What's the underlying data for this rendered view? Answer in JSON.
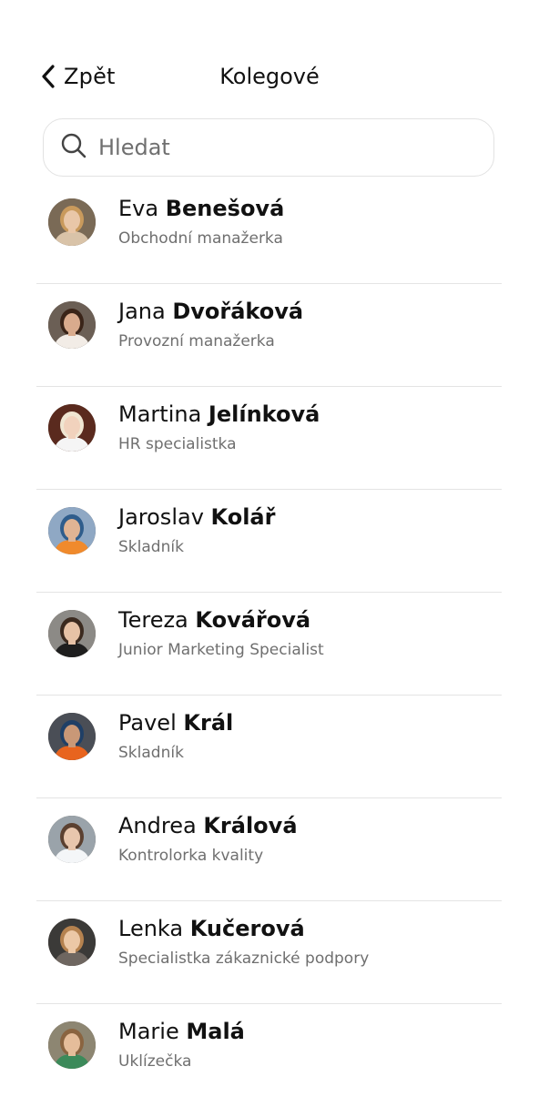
{
  "header": {
    "back_label": "Zpět",
    "title": "Kolegové"
  },
  "search": {
    "placeholder": "Hledat",
    "value": ""
  },
  "colleagues": [
    {
      "first": "Eva",
      "last": "Benešová",
      "role": "Obchodní manažerka",
      "avatar": {
        "bg": "#7a6a56",
        "hair": "#c99a5c",
        "skin": "#e9c7a8",
        "shirt": "#d9c3a8"
      }
    },
    {
      "first": "Jana",
      "last": "Dvořáková",
      "role": "Provozní manažerka",
      "avatar": {
        "bg": "#6b5f55",
        "hair": "#3a2418",
        "skin": "#d9ab8d",
        "shirt": "#f2ece6"
      }
    },
    {
      "first": "Martina",
      "last": "Jelínková",
      "role": "HR specialistka",
      "avatar": {
        "bg": "#5a2a1e",
        "hair": "#f0e6d2",
        "skin": "#f1d2bd",
        "shirt": "#f5f5f5"
      }
    },
    {
      "first": "Jaroslav",
      "last": "Kolář",
      "role": "Skladník",
      "avatar": {
        "bg": "#8fa8c4",
        "hair": "#2f5d8c",
        "skin": "#e0b494",
        "shirt": "#f08a2c"
      }
    },
    {
      "first": "Tereza",
      "last": "Kovářová",
      "role": "Junior Marketing Specialist",
      "avatar": {
        "bg": "#8c8a86",
        "hair": "#3b2a1f",
        "skin": "#e6c2a6",
        "shirt": "#1e1e1e"
      }
    },
    {
      "first": "Pavel",
      "last": "Král",
      "role": "Skladník",
      "avatar": {
        "bg": "#4a4e56",
        "hair": "#1f3f66",
        "skin": "#c99877",
        "shirt": "#e8641e"
      }
    },
    {
      "first": "Andrea",
      "last": "Králová",
      "role": "Kontrolorka kvality",
      "avatar": {
        "bg": "#9aa3aa",
        "hair": "#5b4030",
        "skin": "#e8c6ad",
        "shirt": "#f4f6f8"
      }
    },
    {
      "first": "Lenka",
      "last": "Kučerová",
      "role": "Specialistka zákaznické podpory",
      "avatar": {
        "bg": "#3b3a38",
        "hair": "#b5824f",
        "skin": "#ecc8a6",
        "shirt": "#6e6660"
      }
    },
    {
      "first": "Marie",
      "last": "Malá",
      "role": "Uklízečka",
      "avatar": {
        "bg": "#8d8672",
        "hair": "#8a6440",
        "skin": "#e5bd9a",
        "shirt": "#3c8a5a"
      }
    }
  ]
}
